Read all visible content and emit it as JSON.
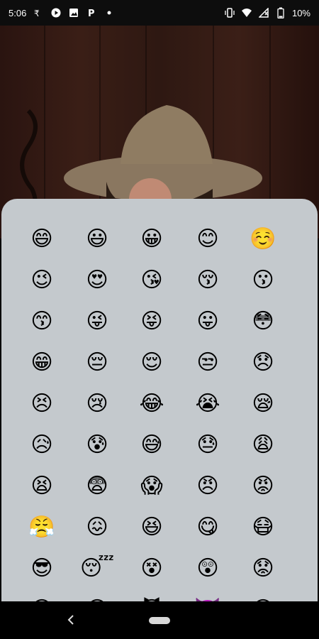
{
  "status_bar": {
    "time": "5:06",
    "battery_percent": "10%",
    "left_icons": [
      "rupee-icon",
      "play-icon",
      "image-icon",
      "paytm-icon",
      "dot-icon"
    ],
    "right_icons": [
      "vibrate-icon",
      "wifi-icon",
      "signal-icon",
      "battery-icon"
    ]
  },
  "emoji_grid": {
    "rows": [
      [
        "😄",
        "😃",
        "😀",
        "😊",
        "☺️"
      ],
      [
        "😉",
        "😍",
        "😘",
        "😚",
        "😗"
      ],
      [
        "😙",
        "😜",
        "😝",
        "😛",
        "😳"
      ],
      [
        "😁",
        "😔",
        "😌",
        "😒",
        "😞"
      ],
      [
        "😣",
        "😢",
        "😂",
        "😭",
        "😪"
      ],
      [
        "😥",
        "😰",
        "😅",
        "😓",
        "😩"
      ],
      [
        "😫",
        "😨",
        "😱",
        "😠",
        "😡"
      ],
      [
        "😤",
        "😖",
        "😆",
        "😋",
        "😷"
      ],
      [
        "😎",
        "😴",
        "😵",
        "😲",
        "😟"
      ],
      [
        "😦",
        "😧",
        "😈",
        "👿",
        "😮"
      ]
    ]
  },
  "nav_bar": {
    "back_icon": "back-chevron-icon",
    "home_icon": "home-pill-icon"
  }
}
